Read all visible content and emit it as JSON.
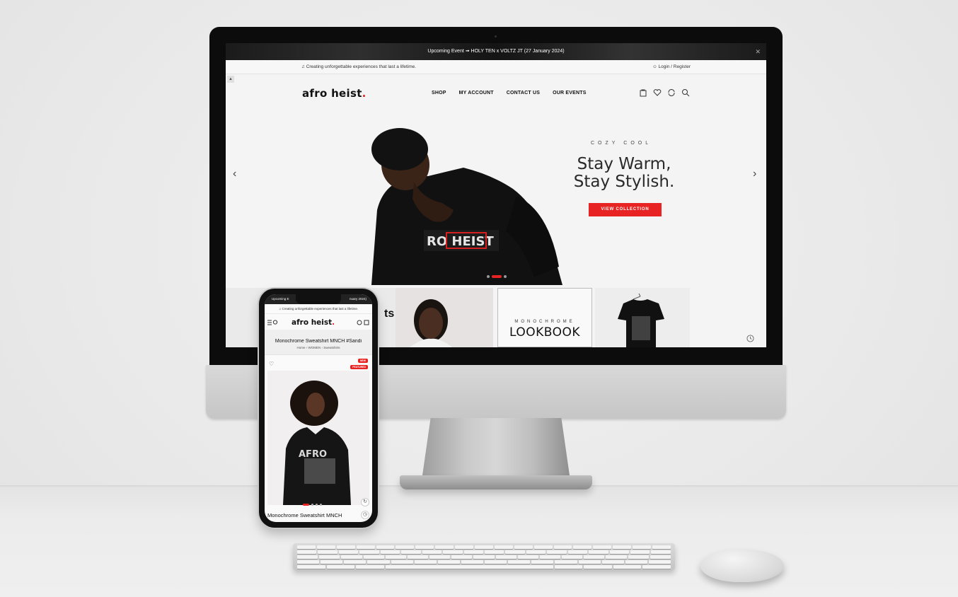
{
  "desktop": {
    "announcement": "Upcoming Event ➟ HOLY TEN x VOLTZ JT (27 January 2024)",
    "tagline": "Creating unforgettable experiences that last a lifetime.",
    "login": "Login / Register",
    "logo": "afro heist",
    "logo_dot": ".",
    "nav": [
      "SHOP",
      "MY ACCOUNT",
      "CONTACT US",
      "OUR EVENTS"
    ],
    "hero": {
      "eyebrow": "COZY COOL",
      "title_line1": "Stay Warm,",
      "title_line2": "Stay Stylish.",
      "button": "VIEW COLLECTION",
      "shirt_text": "RO HEIST"
    },
    "categories": {
      "partial_label": "ts",
      "lookbook_eyebrow": "MONOCHROME",
      "lookbook_title": "LOOKBOOK"
    }
  },
  "mobile": {
    "announcement_left": "Upcoming E",
    "announcement_right": "nuary 2024)",
    "tagline": "Creating unforgettable experiences that last a lifetime.",
    "logo": "afro heist",
    "logo_dot": ".",
    "page_title": "Monochrome Sweatshirt MNCH #Sandi",
    "breadcrumb": "Home  ›  WOMEN  ›  Sweatshirts",
    "badge_new": "NEW",
    "badge_featured": "FEATURED",
    "product_print": "AFRO",
    "product_name": "Monochrome Sweatshirt MNCH"
  },
  "colors": {
    "accent": "#e82323",
    "dark": "#111111",
    "screen_bg": "#f4f4f4"
  },
  "icons": [
    "music-note-icon",
    "user-icon",
    "cart-icon",
    "heart-icon",
    "refresh-icon",
    "search-icon",
    "chevron-left-icon",
    "chevron-right-icon",
    "history-icon",
    "menu-icon"
  ]
}
